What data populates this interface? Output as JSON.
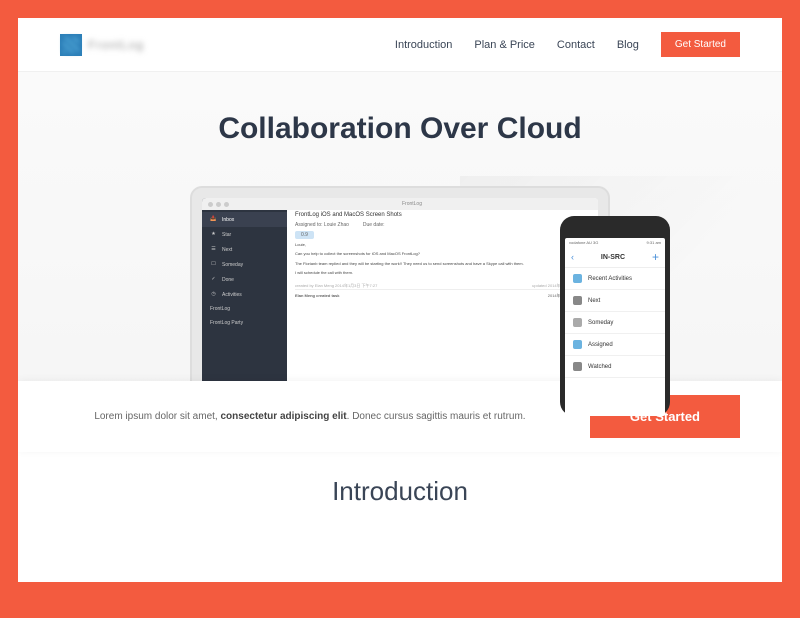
{
  "brand": {
    "name": "FrontLog"
  },
  "nav": {
    "items": [
      "Introduction",
      "Plan & Price",
      "Contact",
      "Blog"
    ],
    "cta": "Get Started"
  },
  "hero": {
    "title": "Collaboration Over Cloud",
    "tagline_pre": "Lorem ipsum dolor sit amet, ",
    "tagline_strong": "consectetur adipiscing elit",
    "tagline_post": ". Donec cursus sagittis mauris et rutrum.",
    "cta": "Get Started"
  },
  "laptop": {
    "window_title": "FrontLog",
    "tab": "Inbox",
    "sidebar": [
      "Inbox",
      "Star",
      "Next",
      "Someday",
      "Done",
      "Activities",
      "FrontLog",
      "FrontLog Party"
    ],
    "task": {
      "title": "FrontLog iOS and MacOS Screen Shots",
      "assignee_label": "Assigned to:",
      "assignee": "Louie Zhao",
      "due_label": "Due date:",
      "progress": "0.9",
      "greeting": "Louie,",
      "body1": "Can you help to collect the screenshots for iOS and MacOS FrontLog?",
      "body2": "The Florianb team replied and they will be starting the work!! They need us to send screenshots and have a Skype call with them.",
      "body3": "I will schedule the call with them.",
      "created_by": "Elan Meng",
      "created_at": "2014年1月3日 下午7:27",
      "updated_at": "2014年1月3日 下午7:27",
      "activity": "Elan Meng created task",
      "activity_time": "2014年1月3日 下午7:27"
    }
  },
  "phone": {
    "status": {
      "carrier": "vodafone AU 3G",
      "time": "9:31 am"
    },
    "title": "IN-SRC",
    "items": [
      "Recent Activities",
      "Next",
      "Someday",
      "Assigned",
      "Watched"
    ]
  },
  "sections": {
    "intro_heading": "Introduction"
  },
  "colors": {
    "accent": "#f35b3f",
    "dark": "#2d3748"
  }
}
